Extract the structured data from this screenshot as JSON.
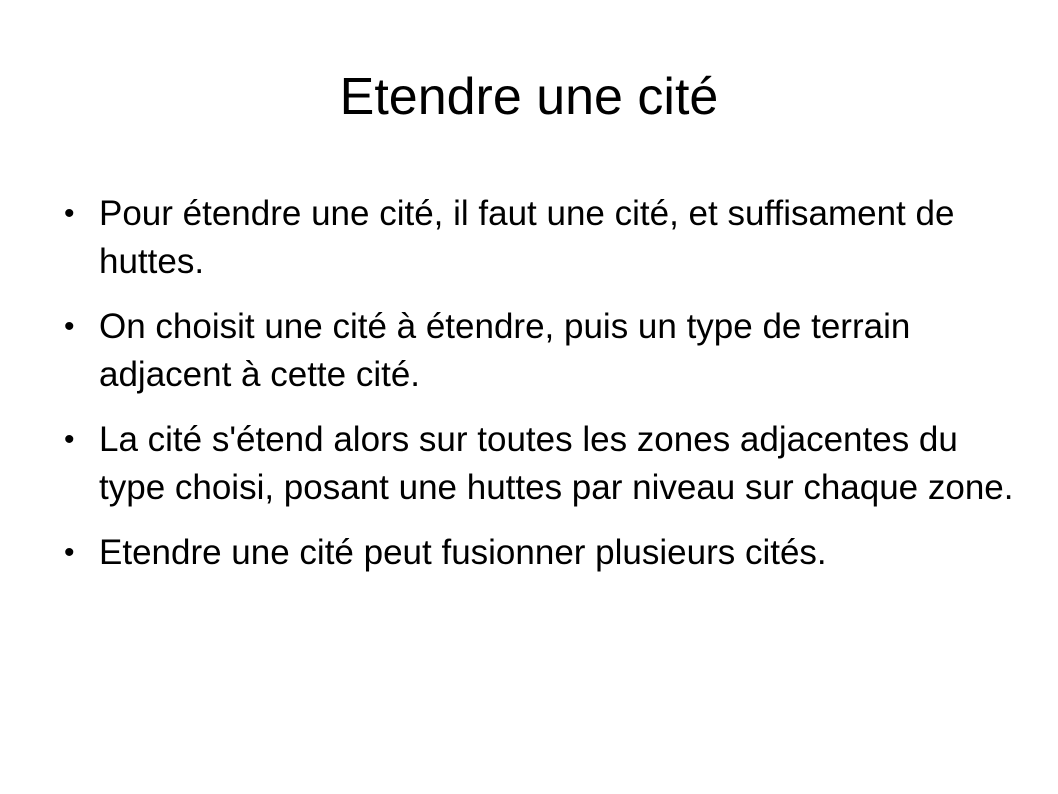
{
  "slide": {
    "title": "Etendre une cité",
    "bullet_symbol": "•",
    "bullets": [
      {
        "text": "Pour étendre une cité, il faut une cité, et suffisament de huttes."
      },
      {
        "text": "On choisit une cité à étendre, puis un type de terrain adjacent à cette cité."
      },
      {
        "text": "La cité s'étend alors sur toutes les zones adjacentes du type choisi, posant une huttes par niveau sur chaque zone."
      },
      {
        "text": "Etendre une cité peut fusionner plusieurs cités."
      }
    ]
  }
}
